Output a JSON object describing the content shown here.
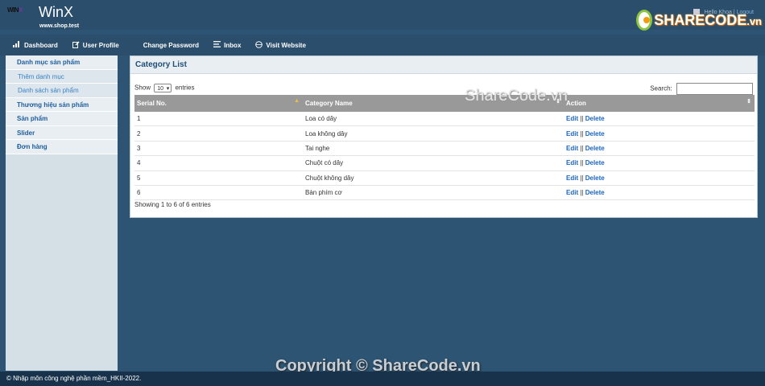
{
  "header": {
    "logo_text": "WIN",
    "logo_accent": "X",
    "title": "WinX",
    "url": "www.shop.test",
    "greeting": "Hello Khoa |",
    "logout": "Logout",
    "watermark_brand": "SHARECODE",
    "watermark_suffix": ".vn"
  },
  "nav": {
    "items": [
      {
        "label": "Dashboard",
        "icon": "bar-chart-icon"
      },
      {
        "label": "User Profile",
        "icon": "edit-icon"
      },
      {
        "label": "Change Password",
        "icon": ""
      },
      {
        "label": "Inbox",
        "icon": "list-icon"
      },
      {
        "label": "Visit Website",
        "icon": "globe-icon"
      }
    ]
  },
  "sidebar": {
    "items": [
      {
        "label": "Danh mục sản phẩm",
        "type": "head"
      },
      {
        "label": "Thêm danh mục",
        "type": "sub"
      },
      {
        "label": "Danh sách sản phẩm",
        "type": "sub"
      },
      {
        "label": "Thương hiệu sản phẩm",
        "type": "head"
      },
      {
        "label": "Sản phẩm",
        "type": "head"
      },
      {
        "label": "Slider",
        "type": "head"
      },
      {
        "label": "Đơn hàng",
        "type": "head"
      }
    ]
  },
  "panel": {
    "title": "Category List",
    "show_label": "Show",
    "page_size": "10",
    "entries_label": "entries",
    "search_label": "Search:",
    "search_value": "",
    "columns": [
      "Serial No.",
      "Category Name",
      "Action"
    ],
    "rows": [
      {
        "no": "1",
        "name": "Loa có dây"
      },
      {
        "no": "2",
        "name": "Loa không dây"
      },
      {
        "no": "3",
        "name": "Tai nghe"
      },
      {
        "no": "4",
        "name": "Chuột có dây"
      },
      {
        "no": "5",
        "name": "Chuột không dây"
      },
      {
        "no": "6",
        "name": "Bàn phím cơ"
      }
    ],
    "edit_label": "Edit",
    "separator": "||",
    "delete_label": "Delete",
    "info": "Showing 1 to 6 of 6 entries"
  },
  "watermarks": {
    "middle": "ShareCode.vn",
    "bottom": "Copyright © ShareCode.vn"
  },
  "footer": {
    "text": "© Nhập môn công nghệ phần mềm_HKII-2022."
  },
  "colors": {
    "background": "#2d5472",
    "header": "#2a4e6c",
    "footer": "#17324a",
    "table_header": "#999999",
    "link": "#1a66c4"
  }
}
